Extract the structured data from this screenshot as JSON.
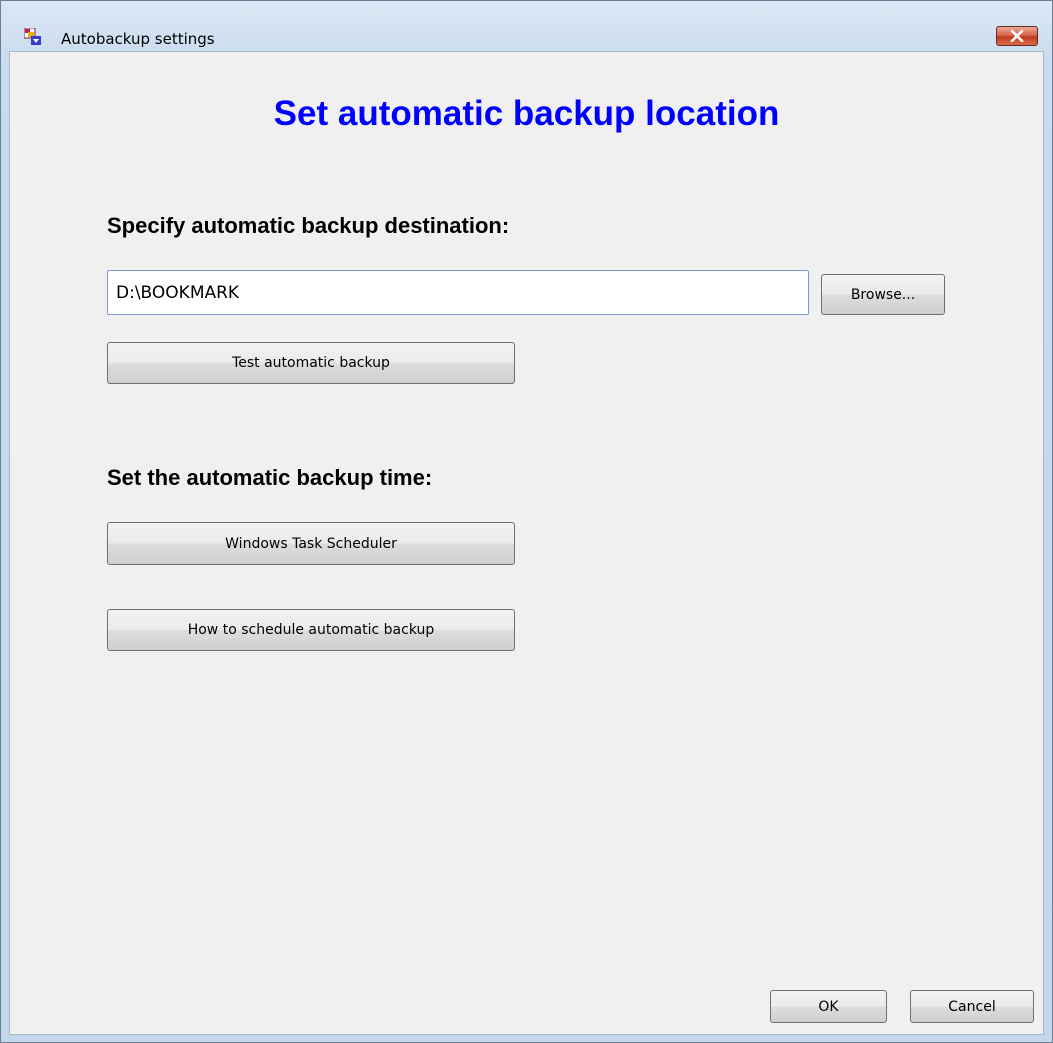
{
  "window": {
    "title": "Autobackup settings",
    "close_icon": "close-icon",
    "app_icon": "app-icon"
  },
  "content": {
    "heading": "Set automatic backup location",
    "heading_color": "#0000ff",
    "destination_label": "Specify automatic backup destination:",
    "destination_value": "D:\\BOOKMARK",
    "browse_label": "Browse...",
    "test_label": "Test automatic backup",
    "time_label": "Set the automatic backup time:",
    "scheduler_label": "Windows Task Scheduler",
    "howto_label": "How to schedule automatic backup"
  },
  "footer": {
    "ok_label": "OK",
    "cancel_label": "Cancel"
  }
}
